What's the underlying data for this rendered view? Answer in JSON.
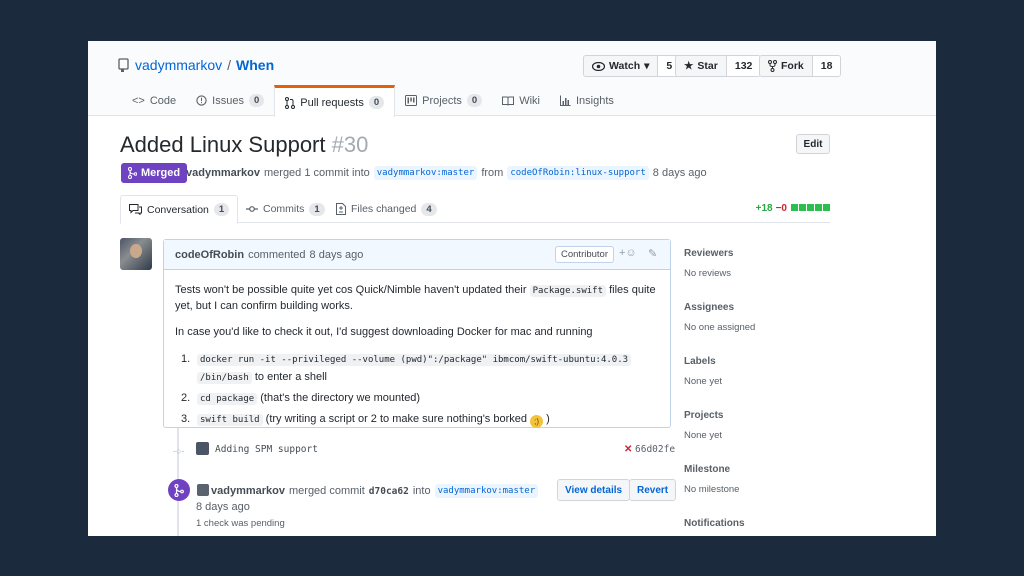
{
  "repo": {
    "owner": "vadymmarkov",
    "separator": "/",
    "name": "When"
  },
  "repo_actions": {
    "watch": {
      "label": "Watch",
      "caret": "▾",
      "count": "5"
    },
    "star": {
      "label": "Star",
      "count": "132"
    },
    "fork": {
      "label": "Fork",
      "count": "18"
    }
  },
  "repo_tabs": [
    {
      "label": "Code",
      "icon": "<>"
    },
    {
      "label": "Issues",
      "count": "0"
    },
    {
      "label": "Pull requests",
      "count": "0"
    },
    {
      "label": "Projects",
      "count": "0"
    },
    {
      "label": "Wiki"
    },
    {
      "label": "Insights"
    }
  ],
  "pr": {
    "title": "Added Linux Support",
    "number": "#30",
    "edit_label": "Edit",
    "status": "Merged",
    "author": "vadymmarkov",
    "merged_text": "merged 1 commit into",
    "base_branch": "vadymmarkov:master",
    "from_text": "from",
    "head_branch": "codeOfRobin:linux-support",
    "time": "8 days ago"
  },
  "pr_tabs": [
    {
      "label": "Conversation",
      "count": "1"
    },
    {
      "label": "Commits",
      "count": "1"
    },
    {
      "label": "Files changed",
      "count": "4"
    }
  ],
  "diffstat": {
    "additions": "+18",
    "deletions": "−0"
  },
  "comment": {
    "author": "codeOfRobin",
    "action": "commented",
    "time": "8 days ago",
    "role_badge": "Contributor",
    "p1_before": "Tests won't be possible quite yet cos Quick/Nimble haven't updated their",
    "p1_code": "Package.swift",
    "p1_after": "files quite yet, but I can confirm building works.",
    "p2": "In case you'd like to check it out, I'd suggest downloading Docker for mac and running",
    "steps": [
      {
        "n": "1.",
        "code": "docker run -it --privileged --volume (pwd)\":/package\" ibmcom/swift-ubuntu:4.0.3",
        "code2": "/bin/bash",
        "text": "to enter a shell"
      },
      {
        "n": "2.",
        "code": "cd package",
        "text": "(that's the directory we mounted)"
      },
      {
        "n": "3.",
        "code": "swift build",
        "text": "(try writing a script or 2 to make sure nothing's borked",
        "tail": ")"
      }
    ]
  },
  "commit": {
    "message": "Adding SPM support",
    "status": "✕",
    "sha": "66d02fe"
  },
  "merge_event": {
    "author": "vadymmarkov",
    "text": "merged commit",
    "sha": "d70ca62",
    "into": "into",
    "branch": "vadymmarkov:master",
    "time": "8 days ago",
    "checks": "1 check was pending",
    "view_details": "View details",
    "revert": "Revert"
  },
  "sidebar": [
    {
      "title": "Reviewers",
      "value": "No reviews"
    },
    {
      "title": "Assignees",
      "value": "No one assigned"
    },
    {
      "title": "Labels",
      "value": "None yet"
    },
    {
      "title": "Projects",
      "value": "None yet"
    },
    {
      "title": "Milestone",
      "value": "No milestone"
    },
    {
      "title": "Notifications",
      "value": ""
    }
  ],
  "colors": {
    "merged": "#6f42c1",
    "link": "#0366d6",
    "tab_accent": "#e36209",
    "backdrop": "#1b2a3d"
  }
}
